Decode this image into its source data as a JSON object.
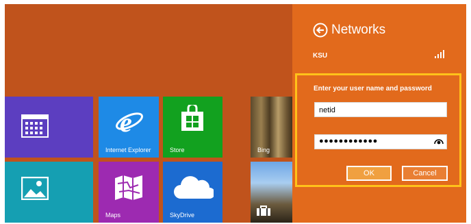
{
  "tiles": {
    "calendar": {
      "label": ""
    },
    "ie": {
      "label": "Internet Explorer"
    },
    "store": {
      "label": "Store"
    },
    "bing": {
      "label": "Bing"
    },
    "photos": {
      "label": ""
    },
    "maps": {
      "label": "Maps"
    },
    "skydrive": {
      "label": "SkyDrive"
    },
    "travel": {
      "label": ""
    }
  },
  "panel": {
    "title": "Networks",
    "network_name": "KSU",
    "prompt": "Enter your user name and password",
    "username_value": "netid",
    "password_masked": "●●●●●●●●●●●●",
    "ok_label": "OK",
    "cancel_label": "Cancel"
  },
  "colors": {
    "background": "#c0531c",
    "panel": "#e26a1c",
    "highlight": "#ffc21a"
  },
  "icons": [
    "calendar-icon",
    "ie-icon",
    "store-icon",
    "photos-icon",
    "maps-icon",
    "cloud-icon",
    "back-arrow-icon",
    "signal-icon",
    "reveal-password-icon"
  ]
}
